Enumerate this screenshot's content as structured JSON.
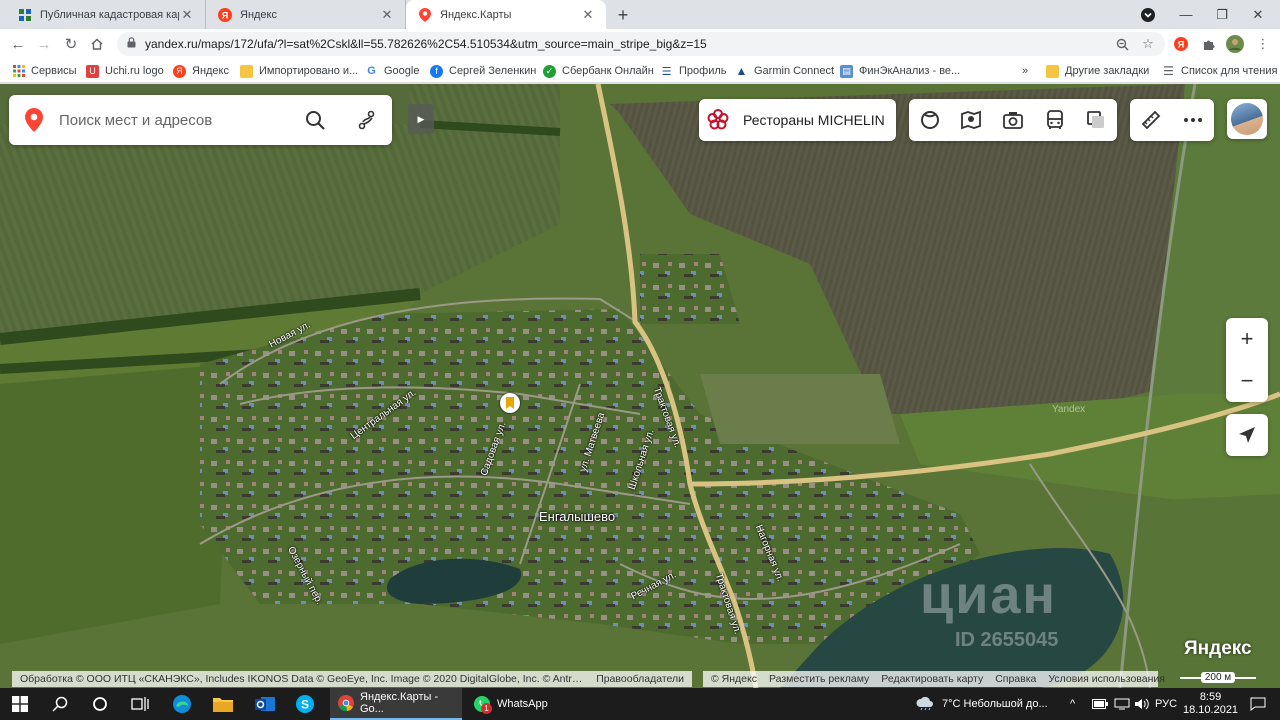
{
  "browser": {
    "tabs": [
      {
        "title": "Публичная кадастровая карта",
        "active": false
      },
      {
        "title": "Яндекс",
        "active": false
      },
      {
        "title": "Яндекс.Карты",
        "active": true
      }
    ],
    "url": "yandex.ru/maps/172/ufa/?l=sat%2Cskl&ll=55.782626%2C54.510534&utm_source=main_stripe_big&z=15"
  },
  "bookmarks": [
    {
      "label": "Сервисы",
      "color": "#4285f4"
    },
    {
      "label": "Uchi.ru logo",
      "color": "#e0413d"
    },
    {
      "label": "Яндекс",
      "color": "#fc3f1d"
    },
    {
      "label": "Импортировано и...",
      "color": "#f5c542"
    },
    {
      "label": "Google",
      "color": "#4285f4"
    },
    {
      "label": "Сергей Зеленкин",
      "color": "#1877f2"
    },
    {
      "label": "Сбербанк Онлайн",
      "color": "#21a038"
    },
    {
      "label": "Профиль",
      "color": "#1e4f9c"
    },
    {
      "label": "Garmin Connect",
      "color": "#1a4a8a"
    },
    {
      "label": "ФинЭкАнализ - ве...",
      "color": "#5a8fcf"
    }
  ],
  "bookmarks_overflow": "»",
  "bookmarks_right": [
    {
      "label": "Другие закладки"
    },
    {
      "label": "Список для чтения"
    }
  ],
  "map": {
    "search_placeholder": "Поиск мест и адресов",
    "michelin_label": "Рестораны MICHELIN",
    "zoom_in": "+",
    "zoom_out": "−",
    "village_label": "Енгалышево",
    "streets": [
      {
        "name": "Новая ул."
      },
      {
        "name": "Центральная ул."
      },
      {
        "name": "Садовая ул."
      },
      {
        "name": "ул. Матвеева"
      },
      {
        "name": "Школьная ул."
      },
      {
        "name": "Трактовая ул."
      },
      {
        "name": "Трактовая ул."
      },
      {
        "name": "Нагорная ул."
      },
      {
        "name": "Речная ул."
      },
      {
        "name": "Озерный пер."
      }
    ],
    "watermark_text": "циан",
    "watermark_id": "ID 2655045",
    "yandex_watermark": "Yandex",
    "logo": "Яндекс",
    "scale_label": "200 м",
    "attribution_left": "Обработка © ООО ИТЦ «СКАНЭКС», Includes IKONOS Data © GeoEye, Inc. Image © 2020 DigitalGlobe, Inc. © Antrix ...",
    "attribution_rights": "Правообладатели",
    "footer_links": [
      "© Яндекс",
      "Разместить рекламу",
      "Редактировать карту",
      "Справка",
      "Условия использования"
    ]
  },
  "taskbar": {
    "apps": [
      {
        "label": "Яндекс.Карты - Go...",
        "active": true
      },
      {
        "label": "WhatsApp",
        "active": false,
        "badge": "1"
      }
    ],
    "weather": "7°C  Небольшой до...",
    "language": "РУС",
    "time": "8:59",
    "date": "18.10.2021"
  }
}
